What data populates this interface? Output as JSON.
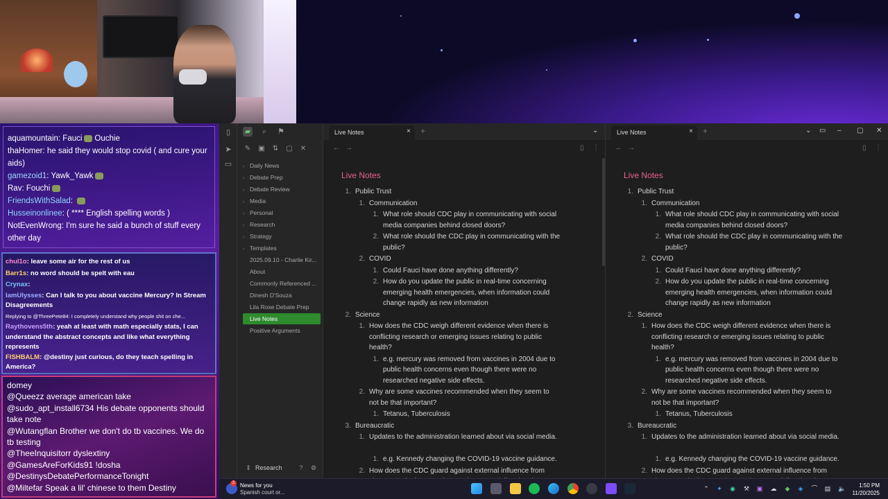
{
  "chat": {
    "box1": [
      {
        "user": "aquamountain",
        "msg": "Fauci",
        "extra": "Ouchie"
      },
      {
        "user": "thaHomer",
        "msg": "he said they would stop covid ( and cure your aids)"
      },
      {
        "user": "gamezoid1",
        "msg": "Yawk_Yawk"
      },
      {
        "user": "Rav",
        "msg": "Fouchi"
      },
      {
        "user": "FriendsWithSalad",
        "msg": ""
      },
      {
        "user": "Husseinonlinee",
        "msg": "( **** English spelling words )"
      },
      {
        "user": "NotEvenWrong",
        "msg": "I'm sure he said a bunch of stuff every other day"
      }
    ],
    "box2": [
      {
        "user": "chul1o",
        "msg": "leave some air for the rest of us"
      },
      {
        "user": "Barr1s",
        "msg": "no word should be spelt with eau"
      },
      {
        "user": "Crynax",
        "msg": ""
      },
      {
        "user": "IamUlysses",
        "msg": "Can I talk to you about vaccine Mercury? In Stream Disagreements"
      },
      {
        "user": "",
        "msg": "Replying to @ThreePete84: I completely understand why people shit on che..."
      },
      {
        "user": "Raythovens5th",
        "msg": "yeah at least with math especially stats, I can understand the abstract concepts and like what everything represents"
      },
      {
        "user": "FISHBALM",
        "msg": "@destiny just curious, do they teach spelling in America?"
      }
    ],
    "box3": [
      "domey",
      "@Queezz average american take",
      "@sudo_apt_install6734 His debate opponents should take note",
      "@Wutangflan Brother we don't do tb vaccines. We do tb testing",
      "@TheeInquisitorr dyslextiny",
      "@GamesAreForKids91 !dosha",
      "@DestinysDebatePerformanceTonight",
      "@Miltefar Speak a lil' chinese to them Destiny"
    ]
  },
  "sidebar": {
    "items": [
      {
        "label": "Daily News",
        "folder": true
      },
      {
        "label": "Debate Prep",
        "folder": true
      },
      {
        "label": "Debate Review",
        "folder": true
      },
      {
        "label": "Media",
        "folder": true
      },
      {
        "label": "Personal",
        "folder": true
      },
      {
        "label": "Research",
        "folder": true
      },
      {
        "label": "Strategy",
        "folder": true
      },
      {
        "label": "Templates",
        "folder": true
      },
      {
        "label": "2025.09.10 - Charlie Kir...",
        "folder": false
      },
      {
        "label": "About",
        "folder": false
      },
      {
        "label": "Commonly Referenced ...",
        "folder": false
      },
      {
        "label": "Dinesh D'Souza",
        "folder": false
      },
      {
        "label": "Lila Rose Debate Prep",
        "folder": false
      },
      {
        "label": "Live Notes",
        "folder": false,
        "active": true
      },
      {
        "label": "Positive Arguments",
        "folder": false
      }
    ],
    "vault": "Research"
  },
  "panes": [
    {
      "tab": "Live Notes",
      "title": "Live Notes"
    },
    {
      "tab": "Live Notes",
      "title": "Live Notes"
    }
  ],
  "note": [
    {
      "lvl": 0,
      "n": "1.",
      "t": "Public Trust"
    },
    {
      "lvl": 1,
      "n": "1.",
      "t": "Communication"
    },
    {
      "lvl": 2,
      "n": "1.",
      "t": "What role should CDC play in communicating with social media companies behind closed doors?"
    },
    {
      "lvl": 2,
      "n": "2.",
      "t": "What role should the CDC play in communicating with the public?"
    },
    {
      "lvl": 1,
      "n": "2.",
      "t": "COVID"
    },
    {
      "lvl": 2,
      "n": "1.",
      "t": "Could Fauci have done anything differently?"
    },
    {
      "lvl": 2,
      "n": "2.",
      "t": "How do you update the public in real-time concerning emerging health emergencies, when information could change rapidly as new information"
    },
    {
      "lvl": 0,
      "n": "2.",
      "t": "Science"
    },
    {
      "lvl": 1,
      "n": "1.",
      "t": "How does the CDC weigh different evidence when there is conflicting research or emerging issues relating to public health?"
    },
    {
      "lvl": 2,
      "n": "1.",
      "t": "e.g. mercury was removed from vaccines in 2004 due to public health concerns even though there were no researched negative side effects."
    },
    {
      "lvl": 1,
      "n": "2.",
      "t": "Why are some vaccines recommended when they seem to not be that important?"
    },
    {
      "lvl": 2,
      "n": "1.",
      "t": "Tetanus, Tuberculosis"
    },
    {
      "lvl": 0,
      "n": "3.",
      "t": "Bureaucratic"
    },
    {
      "lvl": 1,
      "n": "1.",
      "t": "Updates to the administration learned about via social media."
    },
    {
      "lvl": 2,
      "n": "1.",
      "t": "e.g. Kennedy changing the COVID-19 vaccine guidance."
    },
    {
      "lvl": 1,
      "n": "2.",
      "t": "How does the CDC guard against external influence from pharmaceutical companies or other potentially tainted sources of knowledge?"
    }
  ],
  "taskbar": {
    "news_title": "News for you",
    "news_sub": "Spanish court or...",
    "news_badge": "2",
    "time": "1:50 PM",
    "date": "11/20/2025"
  },
  "colors": {
    "accent_title": "#e8638b",
    "active_item": "#2e8b2e"
  }
}
